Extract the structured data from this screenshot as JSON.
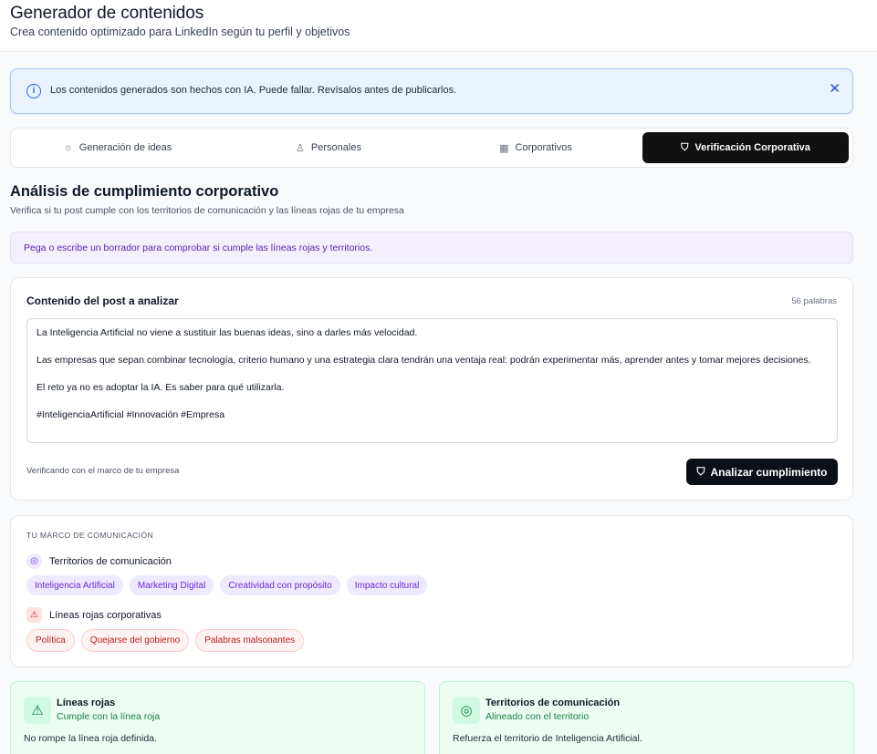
{
  "header": {
    "title": "Generador de contenidos",
    "subtitle": "Crea contenido optimizado para LinkedIn según tu perfil y objetivos"
  },
  "alert": {
    "text": "Los contenidos generados son hechos con IA. Puede fallar. Revísalos antes de publicarlos.",
    "close_icon": "close-icon"
  },
  "tabs": [
    {
      "label": "Generación de ideas",
      "icon": "lightbulb-icon",
      "active": false
    },
    {
      "label": "Personales",
      "icon": "user-icon",
      "active": false
    },
    {
      "label": "Corporativos",
      "icon": "building-icon",
      "active": false
    },
    {
      "label": "Verificación Corporativa",
      "icon": "shield-check-icon",
      "active": true
    }
  ],
  "section": {
    "title": "Análisis de cumplimiento corporativo",
    "subtitle": "Verifica si tu post cumple con los territorios de comunicación y las líneas rojas de tu empresa"
  },
  "hint": "Pega o escribe un borrador para comprobar si cumple las líneas rojas y territorios.",
  "editor": {
    "label": "Contenido del post a analizar",
    "word_count": "56 palabras",
    "lines": [
      "La Inteligencia Artificial no viene a sustituir las buenas ideas, sino a darles más velocidad.",
      "Las empresas que sepan combinar tecnología, criterio humano y una estrategia clara tendrán una ventaja real: podrán experimentar más, aprender antes y tomar mejores decisiones.",
      "El reto ya no es adoptar la IA. Es saber para qué utilizarla.",
      "#InteligenciaArtificial #Innovación #Empresa"
    ],
    "footnote": "Verificando con el marco de tu empresa",
    "analyze_label": "Analizar cumplimiento"
  },
  "framework": {
    "kicker": "TU MARCO DE COMUNICACIÓN",
    "territories_label": "Territorios de comunicación",
    "territories": [
      "Inteligencia Artificial",
      "Marketing Digital",
      "Creatividad con propósito",
      "Impacto cultural"
    ],
    "redlines_label": "Líneas rojas corporativas",
    "redlines": [
      "Política",
      "Quejarse del gobierno",
      "Palabras malsonantes"
    ]
  },
  "results": [
    {
      "title": "Líneas rojas",
      "status": "Cumple con la línea roja",
      "description": "No rompe la línea roja definida.",
      "icon": "warning-triangle-icon"
    },
    {
      "title": "Territorios de comunicación",
      "status": "Alineado con el territorio",
      "description": "Refuerza el territorio de Inteligencia Artificial.",
      "icon": "target-icon"
    }
  ],
  "colors": {
    "accent_dark": "#0b0f17",
    "info_blue": "#2563eb",
    "purple": "#6d28d9",
    "red": "#b91c1c",
    "success_green": "#15803d"
  }
}
